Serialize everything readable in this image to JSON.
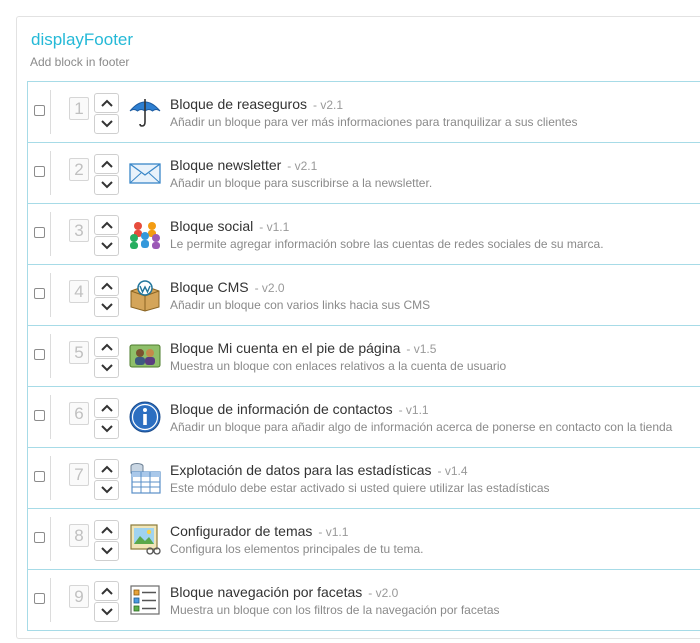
{
  "hook": {
    "title": "displayFooter",
    "description": "Add block in footer"
  },
  "modules": [
    {
      "position": "1",
      "name": "Bloque de reaseguros",
      "version": "- v2.1",
      "description": "Añadir un bloque para ver más informaciones para tranquilizar a sus clientes",
      "icon": "umbrella-icon"
    },
    {
      "position": "2",
      "name": "Bloque newsletter",
      "version": "- v2.1",
      "description": "Añadir un bloque para suscribirse a la newsletter.",
      "icon": "envelope-icon"
    },
    {
      "position": "3",
      "name": "Bloque social",
      "version": "- v1.1",
      "description": "Le permite agregar información sobre las cuentas de redes sociales de su marca.",
      "icon": "social-people-icon"
    },
    {
      "position": "4",
      "name": "Bloque CMS",
      "version": "- v2.0",
      "description": "Añadir un bloque con varios links hacia sus CMS",
      "icon": "cms-box-icon"
    },
    {
      "position": "5",
      "name": "Bloque Mi cuenta en el pie de página",
      "version": "- v1.5",
      "description": "Muestra un bloque con enlaces relativos a la cuenta de usuario",
      "icon": "account-users-icon"
    },
    {
      "position": "6",
      "name": "Bloque de información de contactos",
      "version": "- v1.1",
      "description": "Añadir un bloque para añadir algo de información acerca de ponerse en contacto con la tienda",
      "icon": "info-icon"
    },
    {
      "position": "7",
      "name": "Explotación de datos para las estadísticas",
      "version": "- v1.4",
      "description": "Este módulo debe estar activado si usted quiere utilizar las estadísticas",
      "icon": "database-table-icon"
    },
    {
      "position": "8",
      "name": "Configurador de temas",
      "version": "- v1.1",
      "description": "Configura los elementos principales de tu tema.",
      "icon": "theme-picture-icon"
    },
    {
      "position": "9",
      "name": "Bloque navegación por facetas",
      "version": "- v2.0",
      "description": "Muestra un bloque con los filtros de la navegación por facetas",
      "icon": "faceted-list-icon"
    }
  ]
}
